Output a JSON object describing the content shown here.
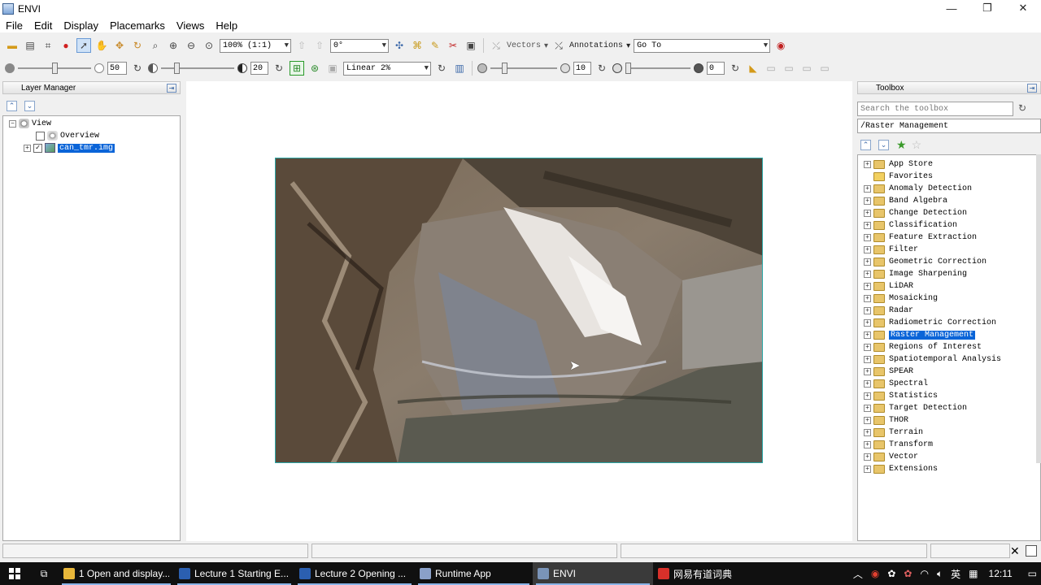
{
  "window": {
    "title": "ENVI"
  },
  "menu": [
    "File",
    "Edit",
    "Display",
    "Placemarks",
    "Views",
    "Help"
  ],
  "toolbar1": {
    "zoom": "100% (1:1)",
    "rotation": "0°",
    "vectors_label": "Vectors",
    "annotations_label": "Annotations",
    "goto": "Go To"
  },
  "toolbar2": {
    "brightness": "50",
    "contrast": "20",
    "stretch": "Linear 2%",
    "sharpen": "10",
    "transparency": "0"
  },
  "layer_manager": {
    "title": "Layer Manager",
    "root": "View",
    "items": [
      {
        "label": "Overview",
        "checked": false
      },
      {
        "label": "can_tmr.img",
        "checked": true
      }
    ]
  },
  "toolbox": {
    "title": "Toolbox",
    "search_placeholder": "Search the toolbox",
    "path": "/Raster Management",
    "categories": [
      "App Store",
      "Favorites",
      "Anomaly Detection",
      "Band Algebra",
      "Change Detection",
      "Classification",
      "Feature Extraction",
      "Filter",
      "Geometric Correction",
      "Image Sharpening",
      "LiDAR",
      "Mosaicking",
      "Radar",
      "Radiometric Correction",
      "Raster Management",
      "Regions of Interest",
      "Spatiotemporal Analysis",
      "SPEAR",
      "Spectral",
      "Statistics",
      "Target Detection",
      "THOR",
      "Terrain",
      "Transform",
      "Vector",
      "Extensions"
    ],
    "selected": "Raster Management"
  },
  "taskbar": {
    "items": [
      {
        "label": "1 Open and display...",
        "color": "#e8b73a"
      },
      {
        "label": "Lecture 1 Starting E...",
        "color": "#2b5fb0"
      },
      {
        "label": "Lecture 2 Opening ...",
        "color": "#2b5fb0"
      },
      {
        "label": "Runtime App",
        "color": "#8aa0c8"
      },
      {
        "label": "ENVI",
        "color": "#7a94b8"
      },
      {
        "label": "网易有道词典",
        "color": "#d8302a"
      }
    ],
    "ime": "英",
    "clock": "12:11"
  }
}
